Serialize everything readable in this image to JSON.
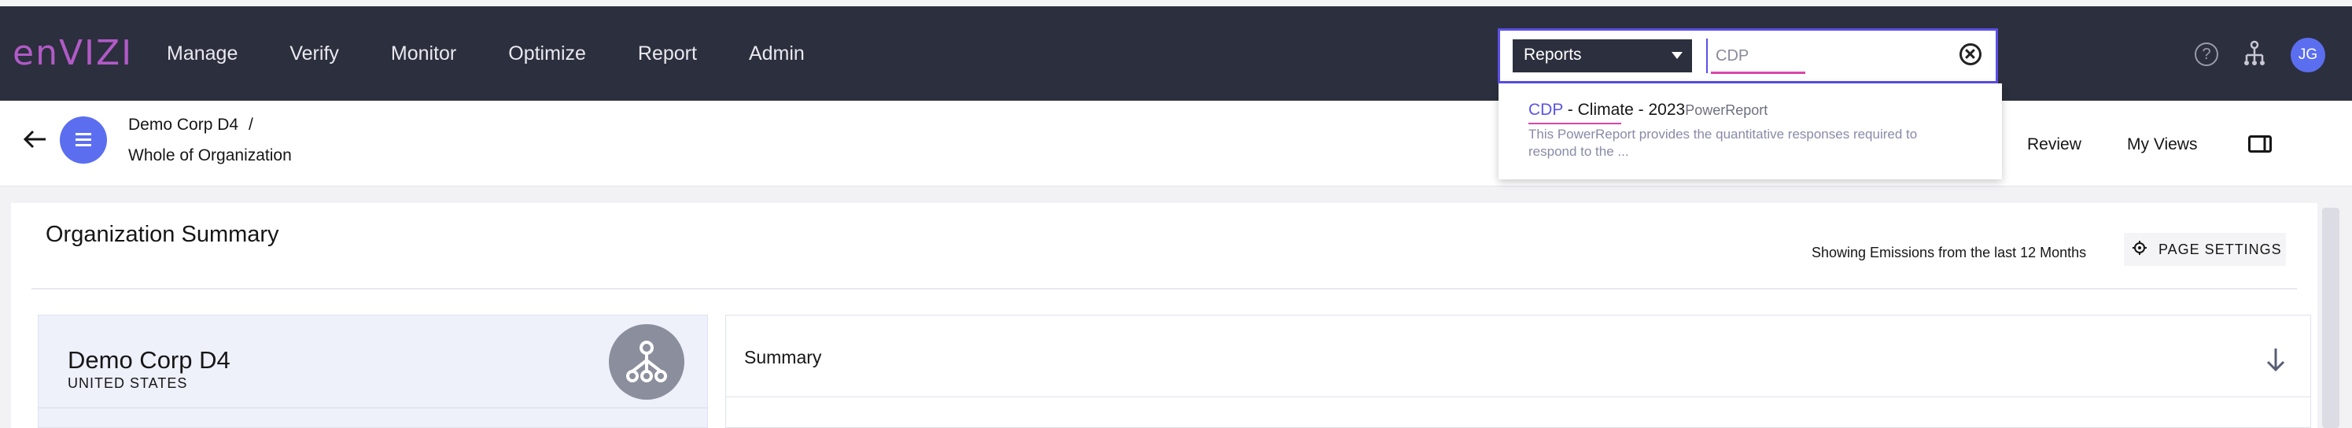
{
  "app": {
    "logo": "enVIZI"
  },
  "nav": {
    "items": [
      "Manage",
      "Verify",
      "Monitor",
      "Optimize",
      "Report",
      "Admin"
    ]
  },
  "search": {
    "scope": "Reports",
    "value": "CDP"
  },
  "header_icons": {
    "help": "help-icon",
    "hierarchy": "hierarchy-icon",
    "avatar_initials": "JG"
  },
  "breadcrumb": {
    "parent": "Demo Corp D4",
    "separator": "/",
    "current": "Whole of Organization"
  },
  "subheader_links": {
    "review": "Review",
    "my_views": "My Views"
  },
  "search_results": [
    {
      "match": "CDP",
      "rest": " - Climate - 2023",
      "type": "PowerReport",
      "description": "This PowerReport provides the quantitative responses required to respond to the ..."
    }
  ],
  "page": {
    "title": "Organization Summary",
    "showing": "Showing Emissions from the last 12 Months",
    "page_settings": "PAGE SETTINGS"
  },
  "org_card": {
    "name": "Demo Corp D4",
    "country": "UNITED STATES"
  },
  "summary": {
    "label": "Summary"
  },
  "colors": {
    "topbar": "#2c2f3d",
    "accent": "#5b6ef0",
    "logo": "#b15ac7",
    "highlight": "#d946a8"
  }
}
